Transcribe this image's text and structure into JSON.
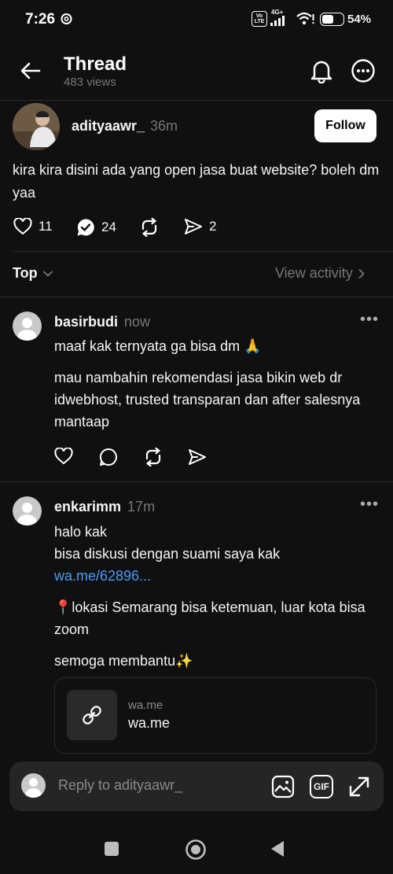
{
  "status_bar": {
    "time": "7:26",
    "network_badge": "Vo LTE",
    "network_type": "4G+",
    "battery": "54%"
  },
  "header": {
    "title": "Thread",
    "views": "483 views",
    "icons": [
      "back-arrow-icon",
      "bell-icon",
      "more-icon"
    ]
  },
  "post": {
    "username": "adityaawr_",
    "time": "36m",
    "follow_label": "Follow",
    "text": "kira kira disini ada yang open jasa buat website? boleh dm yaa",
    "likes": "11",
    "replies": "24",
    "shares": "2"
  },
  "sort": {
    "label": "Top",
    "view_activity": "View activity"
  },
  "comments": [
    {
      "username": "basirbudi",
      "time": "now",
      "lines": [
        "maaf kak ternyata ga bisa dm 🙏",
        "mau nambahin rekomendasi jasa bikin web dr idwebhost, trusted transparan dan after salesnya mantaap"
      ]
    },
    {
      "username": "enkarimm",
      "time": "17m",
      "line1": "halo kak",
      "line2": "bisa diskusi dengan suami saya kak",
      "link": "wa.me/62896...",
      "line3": "📍lokasi Semarang bisa ketemuan, luar kota bisa zoom",
      "line4": "semoga membantu✨",
      "card": {
        "domain": "wa.me",
        "title": "wa.me"
      }
    }
  ],
  "reply_bar": {
    "placeholder": "Reply to adityaawr_",
    "gif_label": "GIF"
  },
  "colors": {
    "background": "#101010",
    "link": "#4c9bf5",
    "muted": "#777777"
  }
}
